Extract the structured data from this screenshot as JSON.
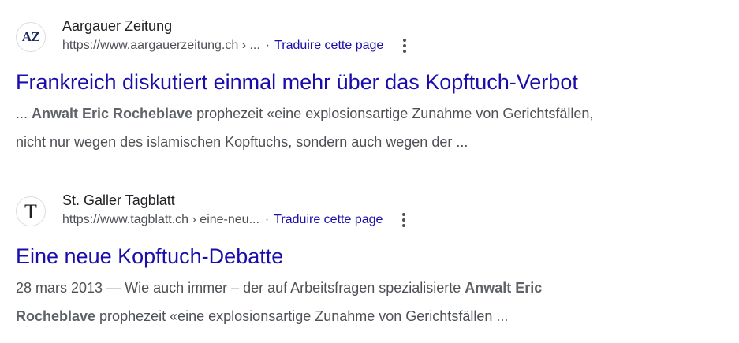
{
  "results": [
    {
      "site_name": "Aargauer Zeitung",
      "favicon_text": "AZ",
      "url": "https://www.aargauerzeitung.ch",
      "breadcrumb": "› ...",
      "separator": "·",
      "translate_label": "Traduire cette page",
      "title": "Frankreich diskutiert einmal mehr über das Kopftuch-Verbot",
      "snippet_prefix": "... ",
      "snippet_bold": "Anwalt Eric Rocheblave",
      "snippet_line1_rest": " prophezeit «eine explosionsartige Zunahme von Gerichtsfällen,",
      "snippet_line2": "nicht nur wegen des islamischen Kopftuchs, sondern auch wegen der ..."
    },
    {
      "site_name": "St. Galler Tagblatt",
      "favicon_text": "T",
      "url": "https://www.tagblatt.ch",
      "breadcrumb": "› eine-neu...",
      "separator": "·",
      "translate_label": "Traduire cette page",
      "title": "Eine neue Kopftuch-Debatte",
      "snippet_date": "28 mars 2013",
      "snippet_prefix": " — Wie auch immer – der auf Arbeitsfragen spezialisierte ",
      "snippet_bold_1": "Anwalt Eric",
      "snippet_bold_2": "Rocheblave",
      "snippet_rest": " prophezeit «eine explosionsartige Zunahme von Gerichtsfällen ..."
    }
  ],
  "icons": {
    "more": "vertical-dots-icon"
  },
  "colors": {
    "link": "#1a0dab",
    "text": "#202124",
    "snippet": "#4d5156"
  }
}
